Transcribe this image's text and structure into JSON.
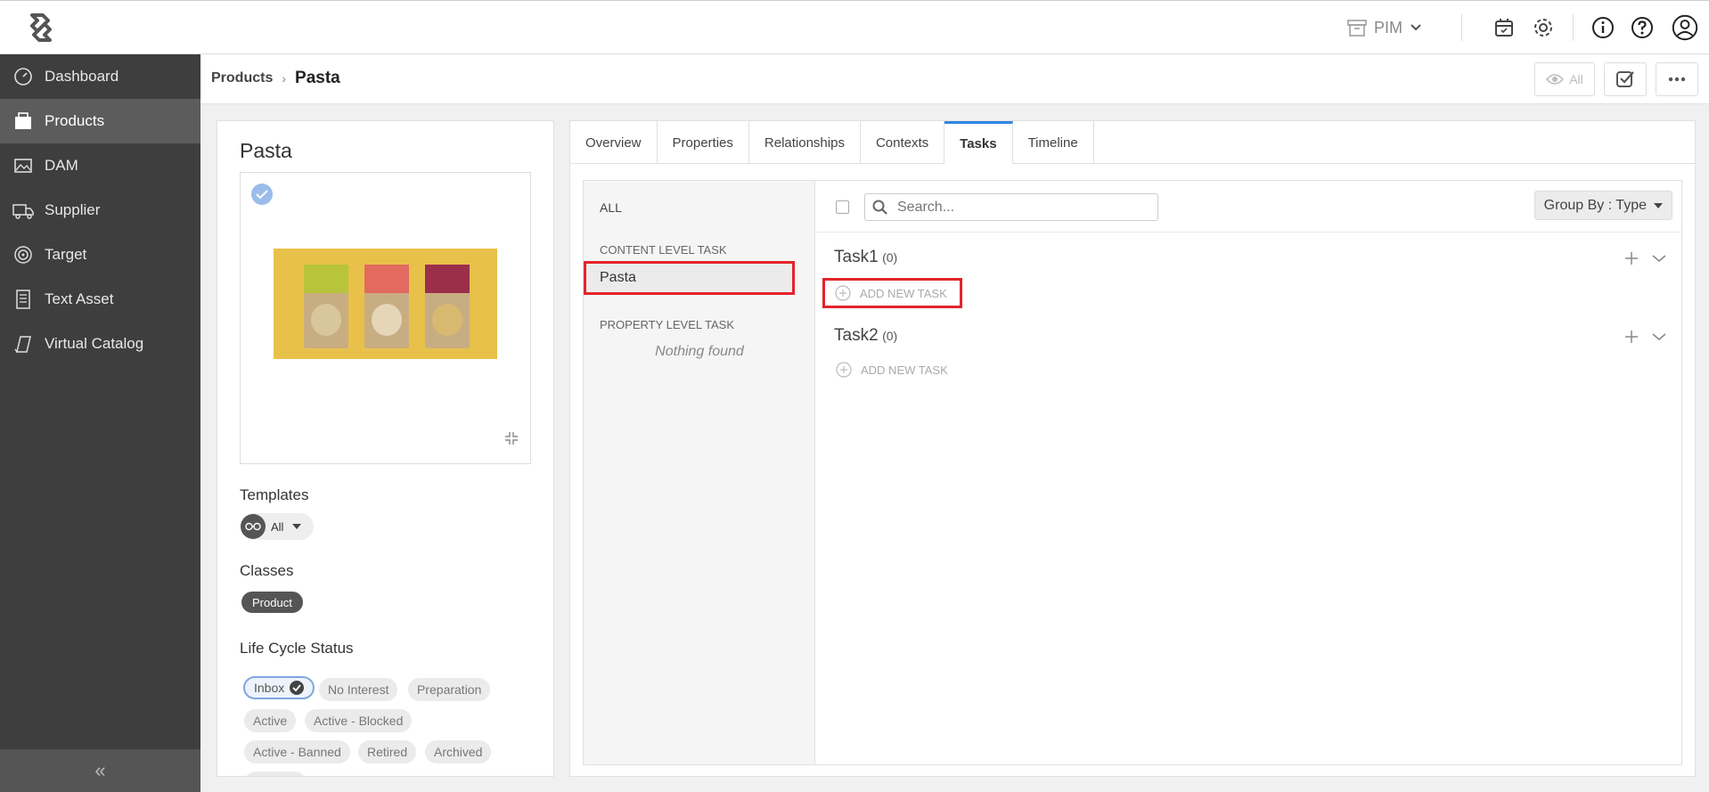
{
  "topbar": {
    "module": "PIM",
    "icons": [
      "calendar-icon",
      "gear-icon",
      "info-icon",
      "help-icon",
      "user-icon"
    ]
  },
  "sidebar": {
    "items": [
      {
        "label": "Dashboard",
        "icon": "dashboard-icon"
      },
      {
        "label": "Products",
        "icon": "products-icon",
        "active": true
      },
      {
        "label": "DAM",
        "icon": "image-icon"
      },
      {
        "label": "Supplier",
        "icon": "truck-icon"
      },
      {
        "label": "Target",
        "icon": "target-icon"
      },
      {
        "label": "Text Asset",
        "icon": "document-icon"
      },
      {
        "label": "Virtual Catalog",
        "icon": "catalog-icon"
      }
    ],
    "collapse": "«"
  },
  "breadcrumb": {
    "root": "Products",
    "separator": "›",
    "current": "Pasta",
    "view_all": "All"
  },
  "product": {
    "title": "Pasta",
    "templates_label": "Templates",
    "template_value": "All",
    "classes_label": "Classes",
    "class_value": "Product",
    "lifecycle_label": "Life Cycle Status",
    "lifecycle": [
      "Inbox",
      "No Interest",
      "Preparation",
      "Active",
      "Active - Blocked",
      "Active - Banned",
      "Retired",
      "Archived"
    ]
  },
  "tabs": [
    "Overview",
    "Properties",
    "Relationships",
    "Contexts",
    "Tasks",
    "Timeline"
  ],
  "active_tab": "Tasks",
  "filters": {
    "all": "ALL",
    "content_heading": "CONTENT LEVEL TASK",
    "content_item": "Pasta",
    "property_heading": "PROPERTY LEVEL TASK",
    "empty": "Nothing found"
  },
  "toolbar": {
    "search_placeholder": "Search...",
    "group_by": "Group By : Type"
  },
  "task_groups": [
    {
      "title": "Task1",
      "count": "(0)",
      "add_label": "ADD NEW TASK"
    },
    {
      "title": "Task2",
      "count": "(0)",
      "add_label": "ADD NEW TASK"
    }
  ]
}
